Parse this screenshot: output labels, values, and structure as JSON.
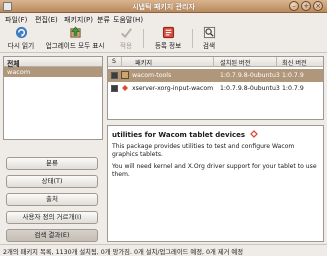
{
  "window": {
    "title": "시냅틱 패키지 관리자"
  },
  "menu": [
    "파일(F)",
    "편집(E)",
    "패키지(P)",
    "분류",
    "도움말(H)"
  ],
  "toolbar": {
    "reload": "다시 읽기",
    "upgrade_all": "업그레이드 모두 표시",
    "apply": "적용",
    "properties": "등록 정보",
    "search": "검색"
  },
  "filter_panel": {
    "header": "전체",
    "selected_item": "wacom"
  },
  "side_buttons": {
    "sections": "분류",
    "status": "상태(T)",
    "origin": "출처",
    "custom_filters": "사용자 정의 거르개(I)",
    "search_results": "검색 결과(E)"
  },
  "package_list": {
    "columns": {
      "s": "S",
      "package": "패키지",
      "installed": "설치된 버전",
      "latest": "최신 버전"
    },
    "rows": [
      {
        "name": "wacom-tools",
        "installed": "1:0.7.9.8-0ubuntu3",
        "latest": "1:0.7.9",
        "selected": true
      },
      {
        "name": "xserver-xorg-input-wacom",
        "installed": "1:0.7.9.8-0ubuntu3",
        "latest": "1:0.7.9",
        "selected": false
      }
    ]
  },
  "description": {
    "title": "utilities for Wacom tablet devices",
    "paragraphs": [
      "This package provides utilities to test and configure Wacom graphics tablets.",
      "You will need kernel and X.Org driver support for your tablet to use them."
    ]
  },
  "statusbar": {
    "text": "2개의 패키지 목록, 1130개 설치됨, 0개 망가짐. 0개 설치/업그레이드 예정, 0개 제거 예정"
  }
}
